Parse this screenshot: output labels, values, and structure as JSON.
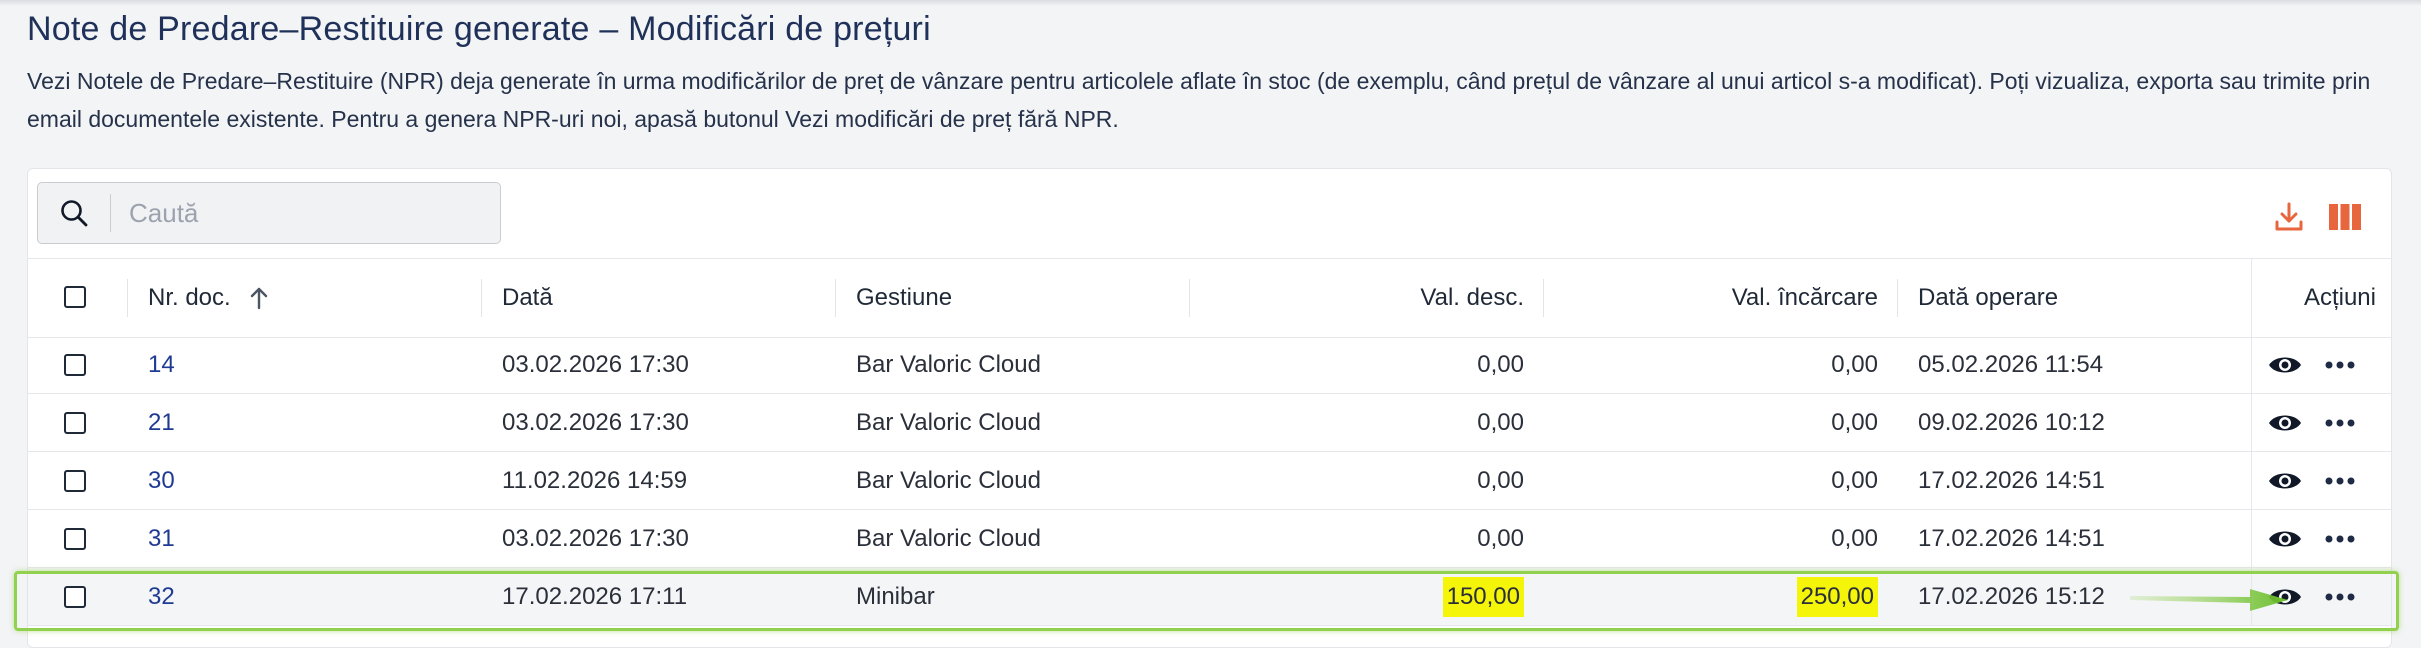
{
  "page": {
    "title": "Note de Predare–Restituire generate – Modificări de prețuri",
    "description": "Vezi Notele de Predare–Restituire (NPR) deja generate în urma modificărilor de preț de vânzare pentru articolele aflate în stoc (de exemplu, când prețul de vânzare al unui articol s-a modificat). Poți vizualiza, exporta sau trimite prin email documentele existente. Pentru a genera NPR-uri noi, apasă butonul Vezi modificări de preț fără NPR."
  },
  "search": {
    "placeholder": "Caută",
    "icon": "search-icon"
  },
  "toolbar": {
    "download_icon": "download-icon",
    "columns_icon": "columns-icon",
    "accent": "#e8663d"
  },
  "table": {
    "headers": {
      "doc_nr": "Nr. doc.",
      "date": "Dată",
      "warehouse": "Gestiune",
      "val_desc": "Val. desc.",
      "val_inc": "Val. încărcare",
      "op_date": "Dată operare",
      "actions": "Acțiuni"
    },
    "sort": {
      "column": "doc_nr",
      "direction": "ascending"
    },
    "rows": [
      {
        "doc_nr": "14",
        "date": "03.02.2026 17:30",
        "warehouse": "Bar Valoric Cloud",
        "val_desc": "0,00",
        "val_inc": "0,00",
        "op_date": "05.02.2026 11:54"
      },
      {
        "doc_nr": "21",
        "date": "03.02.2026 17:30",
        "warehouse": "Bar Valoric Cloud",
        "val_desc": "0,00",
        "val_inc": "0,00",
        "op_date": "09.02.2026 10:12"
      },
      {
        "doc_nr": "30",
        "date": "11.02.2026 14:59",
        "warehouse": "Bar Valoric Cloud",
        "val_desc": "0,00",
        "val_inc": "0,00",
        "op_date": "17.02.2026 14:51"
      },
      {
        "doc_nr": "31",
        "date": "03.02.2026 17:30",
        "warehouse": "Bar Valoric Cloud",
        "val_desc": "0,00",
        "val_inc": "0,00",
        "op_date": "17.02.2026 14:51"
      },
      {
        "doc_nr": "32",
        "date": "17.02.2026 17:11",
        "warehouse": "Minibar",
        "val_desc": "150,00",
        "val_inc": "250,00",
        "op_date": "17.02.2026 15:12",
        "highlighted": true
      }
    ]
  },
  "colors": {
    "title": "#1f3159",
    "link": "#1f3a93",
    "highlight": "#f5f50a",
    "callout": "#92d050"
  }
}
